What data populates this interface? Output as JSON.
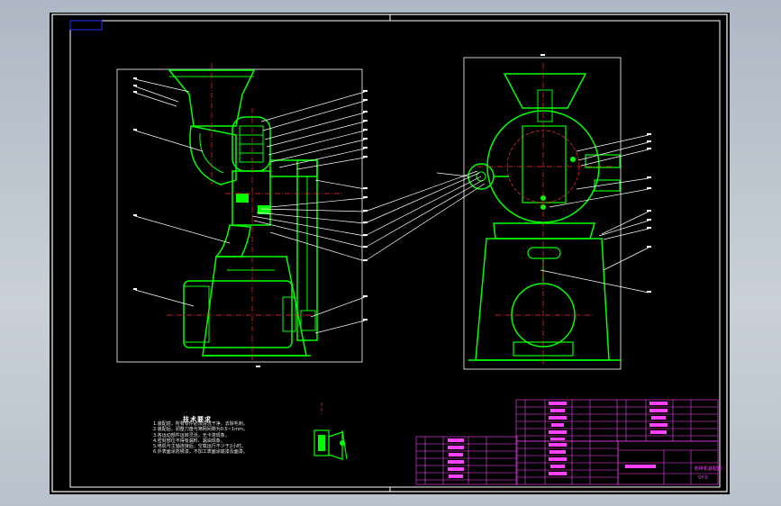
{
  "drawing": {
    "sheet_bg": "#000000",
    "colors": {
      "frame": "#ffffff",
      "outline": "#00ff00",
      "centerline": "#ff3030",
      "leader": "#ffffff",
      "label": "#ffffff",
      "titleblock": "#ff40ff",
      "margin_line": "#2030ff"
    },
    "tech_requirements": {
      "title": "技术要求",
      "lines": [
        "1.装配前，所有零件必须清洗干净，去除毛刺。",
        "2.装配后，调整刀盘与筛网间隙为0.5~1mm。",
        "3.各运动部件运转灵活，无卡滞现象。",
        "4.密封部位不得有漏料、漏油现象。",
        "5.电机与主轴连接后，空载运行不少于2小时。",
        "6.外表面涂防锈漆，不加工表面涂底漆及面漆。"
      ]
    },
    "title_block": {
      "name": "粉碎机装配图",
      "code": "SY-0"
    }
  }
}
